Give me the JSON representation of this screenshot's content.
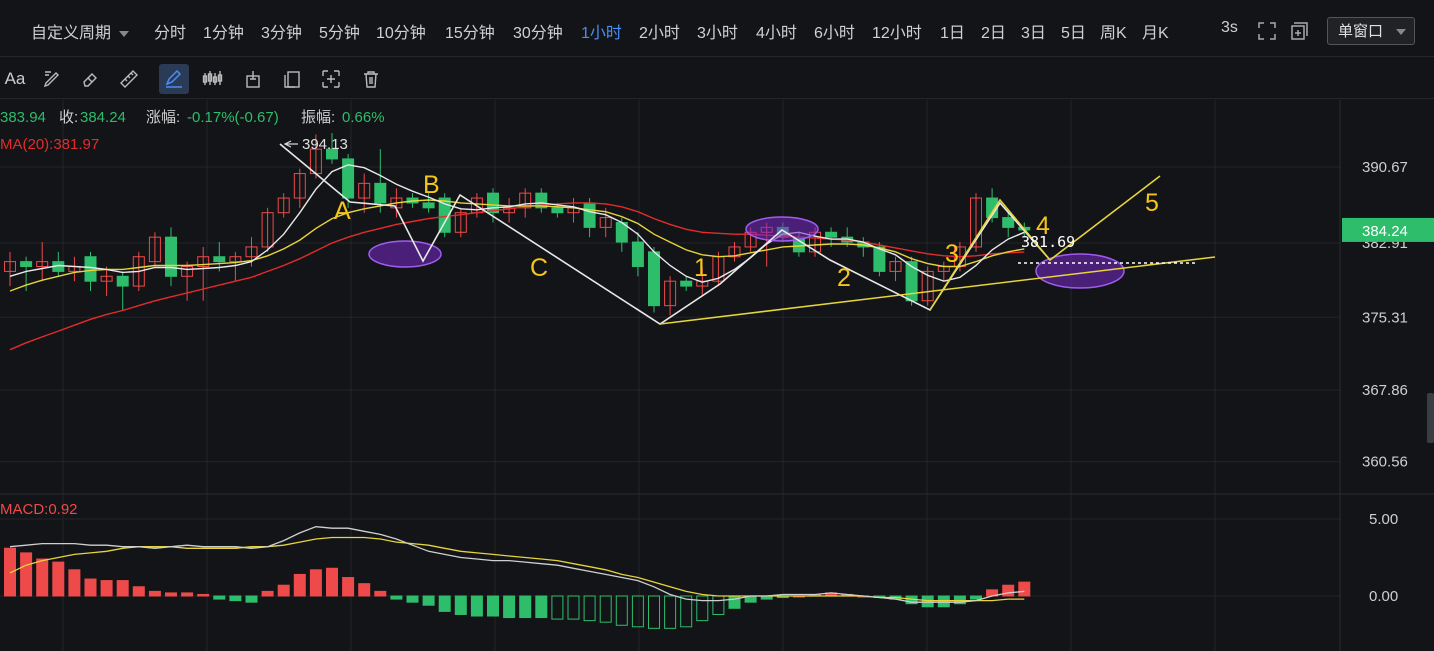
{
  "toolbar": {
    "custom_period_label": "自定义周期",
    "periods": [
      "分时",
      "1分钟",
      "3分钟",
      "5分钟",
      "10分钟",
      "15分钟",
      "30分钟",
      "1小时",
      "2小时",
      "3小时",
      "4小时",
      "6小时",
      "12小时",
      "1日",
      "2日",
      "3日",
      "5日",
      "周K",
      "月K"
    ],
    "active_period": "1小时",
    "refresh_label": "3s",
    "window_mode": "单窗口",
    "draw_tools": [
      "text-tool-icon",
      "brush-tool-icon",
      "eraser-tool-icon",
      "ruler-tool-icon",
      "pencil-tool-icon",
      "wave-pattern-tool-icon",
      "position-tool-icon",
      "copy-tool-icon",
      "settings-tool-icon",
      "trash-tool-icon"
    ],
    "text_tool_label": "Aa"
  },
  "info": {
    "open_value": "383.94",
    "close_label": "收:",
    "close_value": "384.24",
    "change_label": "涨幅:",
    "change_value": "-0.17%(-0.67)",
    "amplitude_label": "振幅:",
    "amplitude_value": "0.66%",
    "ma_label": "MA(20):381.97"
  },
  "chart_data": [
    {
      "type": "candlestick",
      "ylim": [
        357.5,
        396.5
      ],
      "y_ticks": [
        "390.67",
        "375.31",
        "367.86",
        "360.56"
      ],
      "current_price": "384.24",
      "hidden_tick": "382.91",
      "high_annotation": "394.13",
      "last_ma_annotation": "381.69",
      "candles": [
        {
          "o": 380.0,
          "h": 382.0,
          "l": 378.5,
          "c": 381.0
        },
        {
          "o": 381.0,
          "h": 381.5,
          "l": 378.0,
          "c": 380.5
        },
        {
          "o": 380.5,
          "h": 383.0,
          "l": 379.0,
          "c": 381.0
        },
        {
          "o": 381.0,
          "h": 382.0,
          "l": 379.5,
          "c": 380.0
        },
        {
          "o": 380.0,
          "h": 381.5,
          "l": 379.0,
          "c": 380.5
        },
        {
          "o": 381.5,
          "h": 382.0,
          "l": 378.0,
          "c": 379.0
        },
        {
          "o": 379.0,
          "h": 380.5,
          "l": 377.5,
          "c": 379.5
        },
        {
          "o": 379.5,
          "h": 380.0,
          "l": 376.0,
          "c": 378.5
        },
        {
          "o": 378.5,
          "h": 382.0,
          "l": 378.0,
          "c": 381.5
        },
        {
          "o": 381.0,
          "h": 384.0,
          "l": 380.5,
          "c": 383.5
        },
        {
          "o": 383.5,
          "h": 384.5,
          "l": 378.5,
          "c": 379.5
        },
        {
          "o": 379.5,
          "h": 381.0,
          "l": 377.0,
          "c": 380.5
        },
        {
          "o": 380.5,
          "h": 382.5,
          "l": 377.0,
          "c": 381.5
        },
        {
          "o": 381.5,
          "h": 383.0,
          "l": 380.0,
          "c": 381.0
        },
        {
          "o": 381.0,
          "h": 382.0,
          "l": 379.0,
          "c": 381.5
        },
        {
          "o": 381.5,
          "h": 383.5,
          "l": 380.5,
          "c": 382.5
        },
        {
          "o": 382.5,
          "h": 386.5,
          "l": 382.0,
          "c": 386.0
        },
        {
          "o": 386.0,
          "h": 388.0,
          "l": 385.5,
          "c": 387.5
        },
        {
          "o": 387.5,
          "h": 390.5,
          "l": 386.5,
          "c": 390.0
        },
        {
          "o": 390.0,
          "h": 394.0,
          "l": 389.5,
          "c": 392.5
        },
        {
          "o": 392.5,
          "h": 394.13,
          "l": 391.0,
          "c": 391.5
        },
        {
          "o": 391.5,
          "h": 392.0,
          "l": 386.5,
          "c": 387.5
        },
        {
          "o": 387.5,
          "h": 390.0,
          "l": 386.0,
          "c": 389.0
        },
        {
          "o": 389.0,
          "h": 392.5,
          "l": 386.0,
          "c": 387.0
        },
        {
          "o": 386.5,
          "h": 388.5,
          "l": 385.5,
          "c": 387.5
        },
        {
          "o": 387.5,
          "h": 388.0,
          "l": 386.5,
          "c": 387.0
        },
        {
          "o": 387.0,
          "h": 388.0,
          "l": 386.0,
          "c": 386.5
        },
        {
          "o": 387.5,
          "h": 388.0,
          "l": 383.5,
          "c": 384.0
        },
        {
          "o": 384.0,
          "h": 386.5,
          "l": 383.5,
          "c": 386.0
        },
        {
          "o": 386.0,
          "h": 388.0,
          "l": 385.5,
          "c": 387.5
        },
        {
          "o": 388.0,
          "h": 388.5,
          "l": 385.0,
          "c": 386.0
        },
        {
          "o": 386.0,
          "h": 387.5,
          "l": 385.0,
          "c": 386.5
        },
        {
          "o": 386.5,
          "h": 388.5,
          "l": 385.5,
          "c": 388.0
        },
        {
          "o": 388.0,
          "h": 388.5,
          "l": 386.0,
          "c": 386.5
        },
        {
          "o": 386.5,
          "h": 387.0,
          "l": 385.5,
          "c": 386.0
        },
        {
          "o": 386.0,
          "h": 387.5,
          "l": 385.0,
          "c": 386.5
        },
        {
          "o": 387.0,
          "h": 387.5,
          "l": 383.5,
          "c": 384.5
        },
        {
          "o": 384.5,
          "h": 386.5,
          "l": 383.5,
          "c": 385.5
        },
        {
          "o": 385.0,
          "h": 385.5,
          "l": 382.0,
          "c": 383.0
        },
        {
          "o": 383.0,
          "h": 384.0,
          "l": 379.5,
          "c": 380.5
        },
        {
          "o": 382.0,
          "h": 382.5,
          "l": 375.8,
          "c": 376.5
        },
        {
          "o": 376.5,
          "h": 379.5,
          "l": 375.5,
          "c": 379.0
        },
        {
          "o": 379.0,
          "h": 379.5,
          "l": 378.0,
          "c": 378.5
        },
        {
          "o": 378.5,
          "h": 380.5,
          "l": 377.5,
          "c": 379.0
        },
        {
          "o": 379.0,
          "h": 382.0,
          "l": 378.5,
          "c": 381.5
        },
        {
          "o": 381.5,
          "h": 383.0,
          "l": 381.0,
          "c": 382.5
        },
        {
          "o": 382.5,
          "h": 384.5,
          "l": 382.0,
          "c": 384.0
        },
        {
          "o": 384.0,
          "h": 385.0,
          "l": 380.5,
          "c": 384.5
        },
        {
          "o": 384.5,
          "h": 385.0,
          "l": 383.0,
          "c": 383.5
        },
        {
          "o": 383.5,
          "h": 384.0,
          "l": 381.5,
          "c": 382.0
        },
        {
          "o": 382.0,
          "h": 384.5,
          "l": 381.5,
          "c": 384.0
        },
        {
          "o": 384.0,
          "h": 384.5,
          "l": 382.5,
          "c": 383.5
        },
        {
          "o": 383.5,
          "h": 384.5,
          "l": 382.5,
          "c": 383.0
        },
        {
          "o": 383.0,
          "h": 383.5,
          "l": 381.5,
          "c": 382.5
        },
        {
          "o": 382.5,
          "h": 383.0,
          "l": 379.5,
          "c": 380.0
        },
        {
          "o": 380.0,
          "h": 381.5,
          "l": 379.0,
          "c": 381.0
        },
        {
          "o": 381.0,
          "h": 381.5,
          "l": 376.5,
          "c": 377.0
        },
        {
          "o": 377.0,
          "h": 380.5,
          "l": 376.5,
          "c": 380.0
        },
        {
          "o": 380.0,
          "h": 381.0,
          "l": 379.0,
          "c": 380.5
        },
        {
          "o": 380.5,
          "h": 383.0,
          "l": 380.0,
          "c": 382.5
        },
        {
          "o": 382.5,
          "h": 388.0,
          "l": 382.0,
          "c": 387.5
        },
        {
          "o": 387.5,
          "h": 388.5,
          "l": 385.0,
          "c": 385.5
        },
        {
          "o": 385.5,
          "h": 386.0,
          "l": 383.5,
          "c": 384.5
        },
        {
          "o": 384.5,
          "h": 385.0,
          "l": 383.5,
          "c": 384.24
        }
      ],
      "ma_yellow": [
        378.0,
        378.6,
        379.1,
        379.5,
        379.9,
        380.1,
        380.2,
        380.2,
        380.4,
        380.6,
        380.6,
        380.6,
        380.7,
        380.8,
        380.9,
        381.1,
        381.6,
        382.3,
        383.2,
        384.4,
        385.4,
        386.0,
        386.4,
        386.7,
        387.0,
        387.2,
        387.3,
        387.2,
        387.0,
        386.9,
        386.8,
        386.7,
        386.7,
        386.7,
        386.6,
        386.5,
        386.3,
        386.1,
        385.6,
        384.9,
        383.8,
        383.0,
        382.2,
        381.7,
        381.5,
        381.6,
        381.9,
        382.2,
        382.5,
        382.6,
        382.7,
        382.8,
        382.8,
        382.7,
        382.4,
        382.0,
        381.3,
        380.8,
        380.5,
        380.5,
        381.0,
        381.6,
        382.0,
        382.3
      ],
      "ma_red": [
        372.0,
        372.7,
        373.3,
        373.9,
        374.5,
        375.1,
        375.6,
        376.0,
        376.5,
        377.0,
        377.4,
        377.8,
        378.2,
        378.6,
        379.0,
        379.4,
        380.0,
        380.6,
        381.3,
        382.1,
        382.9,
        383.5,
        384.0,
        384.4,
        384.8,
        385.1,
        385.4,
        385.6,
        385.8,
        386.0,
        386.2,
        386.4,
        386.6,
        386.8,
        386.9,
        387.0,
        387.0,
        386.9,
        386.6,
        386.1,
        385.4,
        384.8,
        384.3,
        384.0,
        383.9,
        383.8,
        383.8,
        383.7,
        383.6,
        383.5,
        383.4,
        383.3,
        383.2,
        383.0,
        382.7,
        382.4,
        382.1,
        381.8,
        381.6,
        381.5,
        381.6,
        381.8,
        381.9,
        381.97
      ],
      "ma_white": [
        379.5,
        380.0,
        380.3,
        380.6,
        380.5,
        380.4,
        380.2,
        379.9,
        380.0,
        380.4,
        380.4,
        380.2,
        380.3,
        380.4,
        380.6,
        381.0,
        382.2,
        383.8,
        386.0,
        388.4,
        390.2,
        390.9,
        390.6,
        389.8,
        388.9,
        388.2,
        387.6,
        386.9,
        386.4,
        386.3,
        386.5,
        386.6,
        386.9,
        387.0,
        386.8,
        386.6,
        386.1,
        385.8,
        385.0,
        383.8,
        382.0,
        380.6,
        379.5,
        378.9,
        379.3,
        380.2,
        381.4,
        382.8,
        383.8,
        384.0,
        383.6,
        383.3,
        383.3,
        383.0,
        382.3,
        381.7,
        380.5,
        379.6,
        379.0,
        379.4,
        380.6,
        382.2,
        383.3,
        384.0
      ]
    },
    {
      "type": "bar",
      "title": "MACD:0.92",
      "ylim": [
        -2.0,
        6.5
      ],
      "y_ticks": [
        "5.00",
        "0.00"
      ],
      "hist": [
        3.1,
        2.8,
        2.4,
        2.2,
        1.7,
        1.1,
        1.0,
        1.0,
        0.6,
        0.3,
        0.2,
        0.2,
        0.1,
        -0.2,
        -0.3,
        -0.4,
        0.3,
        0.7,
        1.4,
        1.7,
        1.8,
        1.2,
        0.8,
        0.3,
        -0.2,
        -0.4,
        -0.6,
        -1.0,
        -1.2,
        -1.3,
        -1.3,
        -1.4,
        -1.4,
        -1.4,
        -1.5,
        -1.5,
        -1.6,
        -1.7,
        -1.9,
        -2.0,
        -2.1,
        -2.1,
        -2.0,
        -1.6,
        -1.2,
        -0.8,
        -0.4,
        -0.2,
        -0.1,
        0.0,
        0.1,
        0.2,
        0.1,
        0.0,
        -0.1,
        -0.2,
        -0.5,
        -0.7,
        -0.7,
        -0.5,
        -0.2,
        0.4,
        0.7,
        0.9
      ],
      "dif": [
        3.2,
        3.3,
        3.4,
        3.4,
        3.4,
        3.3,
        3.3,
        3.2,
        3.2,
        3.1,
        3.2,
        3.3,
        3.2,
        3.2,
        3.2,
        3.1,
        3.2,
        3.6,
        4.1,
        4.5,
        4.4,
        4.4,
        4.2,
        4.0,
        3.7,
        3.3,
        2.9,
        2.7,
        2.5,
        2.4,
        2.3,
        2.3,
        2.2,
        2.1,
        2.0,
        1.8,
        1.6,
        1.4,
        1.2,
        1.0,
        0.6,
        0.1,
        -0.2,
        -0.3,
        -0.3,
        -0.2,
        0.0,
        0.0,
        0.1,
        0.1,
        0.1,
        0.2,
        0.1,
        0.0,
        -0.1,
        -0.2,
        -0.4,
        -0.4,
        -0.4,
        -0.4,
        -0.3,
        0.0,
        0.2,
        0.3
      ],
      "dea": [
        1.5,
        2.0,
        2.3,
        2.5,
        2.7,
        2.8,
        2.9,
        3.1,
        3.2,
        3.2,
        3.2,
        3.1,
        3.1,
        3.1,
        3.1,
        3.2,
        3.2,
        3.3,
        3.5,
        3.7,
        3.8,
        3.8,
        3.8,
        3.7,
        3.5,
        3.4,
        3.3,
        3.1,
        2.9,
        2.8,
        2.7,
        2.6,
        2.5,
        2.4,
        2.3,
        2.1,
        1.9,
        1.7,
        1.4,
        1.2,
        0.9,
        0.6,
        0.3,
        0.1,
        0.0,
        0.0,
        0.0,
        0.0,
        0.0,
        0.0,
        0.0,
        0.0,
        0.0,
        0.0,
        -0.1,
        -0.1,
        -0.2,
        -0.3,
        -0.3,
        -0.3,
        -0.3,
        -0.3,
        -0.2,
        -0.2
      ]
    }
  ],
  "annotations": {
    "labels": [
      "A",
      "B",
      "C",
      "1",
      "2",
      "3",
      "4",
      "5"
    ]
  },
  "colors": {
    "bg": "#131417",
    "up": "#ef4a4a",
    "down": "#2ebd6b",
    "ma_yellow": "#e6d43a",
    "ma_red": "#e22c2c",
    "ma_white": "#e8e8e8",
    "wave_label": "#f5c518",
    "ellipse": "#8a3dd6",
    "grid": "#23252a",
    "price_tag": "#2ebd6b",
    "active": "#4a8df6"
  }
}
